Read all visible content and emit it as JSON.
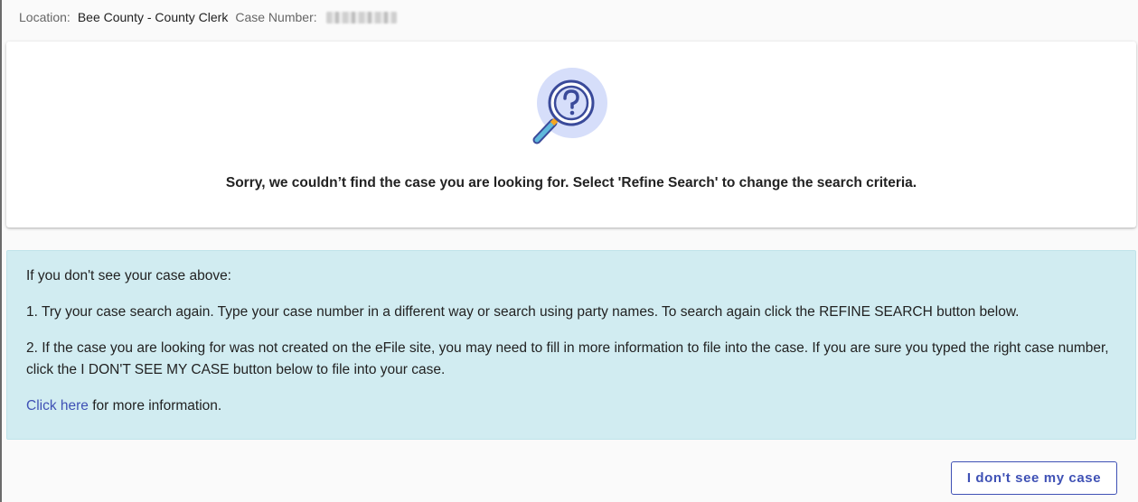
{
  "header": {
    "location_label": "Location:",
    "location_value": "Bee County - County Clerk",
    "case_number_label": "Case Number:"
  },
  "not_found": {
    "icon": "magnifier-question-icon",
    "message": "Sorry, we couldn’t find the case you are looking for. Select 'Refine Search' to change the search criteria."
  },
  "info_box": {
    "intro": "If you don't see your case above:",
    "step1": "1. Try your case search again. Type your case number in a different way or search using party names. To search again click the REFINE SEARCH button below.",
    "step2": "2. If the case you are looking for was not created on the eFile site, you may need to fill in more information to file into the case. If you are sure you typed the right case number, click the I DON'T SEE MY CASE button below to file into your case.",
    "link_text": "Click here",
    "link_suffix": " for more information."
  },
  "actions": {
    "dont_see_case_label": "I don't see my case"
  },
  "colors": {
    "accent": "#3f51b5",
    "info_bg": "#d1ecf1"
  }
}
